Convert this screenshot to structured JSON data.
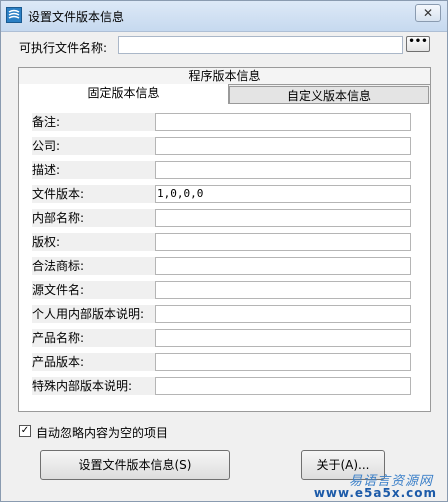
{
  "window": {
    "title": "设置文件版本信息",
    "close_label": "✕"
  },
  "exe": {
    "label": "可执行文件名称:",
    "value": "",
    "browse_label": "•••"
  },
  "group": {
    "title": "程序版本信息",
    "tabs": [
      {
        "label": "固定版本信息",
        "active": true
      },
      {
        "label": "自定义版本信息",
        "active": false
      }
    ]
  },
  "fields": [
    {
      "label": "备注:",
      "value": ""
    },
    {
      "label": "公司:",
      "value": ""
    },
    {
      "label": "描述:",
      "value": ""
    },
    {
      "label": "文件版本:",
      "value": "1,0,0,0"
    },
    {
      "label": "内部名称:",
      "value": ""
    },
    {
      "label": "版权:",
      "value": ""
    },
    {
      "label": "合法商标:",
      "value": ""
    },
    {
      "label": "源文件名:",
      "value": ""
    },
    {
      "label": "个人用内部版本说明:",
      "value": ""
    },
    {
      "label": "产品名称:",
      "value": ""
    },
    {
      "label": "产品版本:",
      "value": ""
    },
    {
      "label": "特殊内部版本说明:",
      "value": ""
    }
  ],
  "options": {
    "auto_ignore_label": "自动忽略内容为空的项目",
    "auto_ignore_checked": true,
    "check_mark": "✓"
  },
  "buttons": {
    "set_label": "设置文件版本信息(S)",
    "about_label": "关于(A)..."
  },
  "watermark": {
    "line1": "易语言资源网",
    "line2": "www.e5a5x.com"
  }
}
